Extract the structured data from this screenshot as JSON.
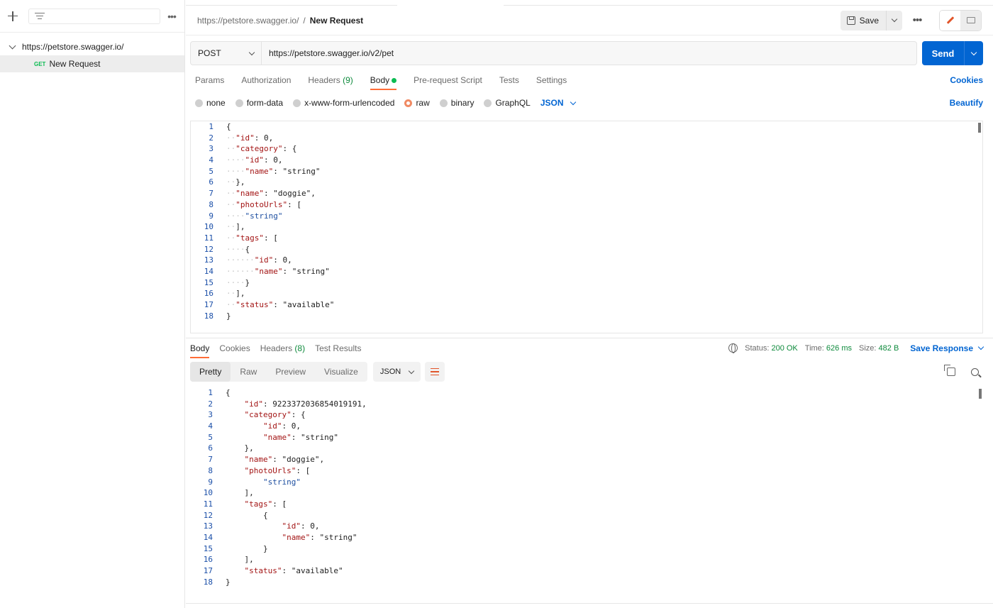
{
  "sidebar": {
    "collection_name": "https://petstore.swagger.io/",
    "request": {
      "method": "GET",
      "name": "New Request"
    }
  },
  "header": {
    "breadcrumb_parent": "https://petstore.swagger.io/",
    "breadcrumb_sep": "/",
    "breadcrumb_current": "New Request",
    "save_label": "Save"
  },
  "request": {
    "method": "POST",
    "url": "https://petstore.swagger.io/v2/pet",
    "send_label": "Send",
    "tabs": {
      "params": "Params",
      "authorization": "Authorization",
      "headers": "Headers",
      "headers_count": "(9)",
      "body": "Body",
      "prerequest": "Pre-request Script",
      "tests": "Tests",
      "settings": "Settings",
      "cookies": "Cookies"
    },
    "body_types": [
      "none",
      "form-data",
      "x-www-form-urlencoded",
      "raw",
      "binary",
      "GraphQL"
    ],
    "body_type_selected": "raw",
    "format": "JSON",
    "beautify": "Beautify",
    "body_lines": [
      "{",
      "  \"id\": 0,",
      "  \"category\": {",
      "    \"id\": 0,",
      "    \"name\": \"string\"",
      "  },",
      "  \"name\": \"doggie\",",
      "  \"photoUrls\": [",
      "    \"string\"",
      "  ],",
      "  \"tags\": [",
      "    {",
      "      \"id\": 0,",
      "      \"name\": \"string\"",
      "    }",
      "  ],",
      "  \"status\": \"available\"",
      "}"
    ]
  },
  "response": {
    "tabs": {
      "body": "Body",
      "cookies": "Cookies",
      "headers": "Headers",
      "headers_count": "(8)",
      "tests": "Test Results"
    },
    "status_label": "Status:",
    "status_value": "200 OK",
    "time_label": "Time:",
    "time_value": "626 ms",
    "size_label": "Size:",
    "size_value": "482 B",
    "save_response": "Save Response",
    "views": [
      "Pretty",
      "Raw",
      "Preview",
      "Visualize"
    ],
    "view_selected": "Pretty",
    "format": "JSON",
    "body_lines": [
      "{",
      "    \"id\": 9223372036854019191,",
      "    \"category\": {",
      "        \"id\": 0,",
      "        \"name\": \"string\"",
      "    },",
      "    \"name\": \"doggie\",",
      "    \"photoUrls\": [",
      "        \"string\"",
      "    ],",
      "    \"tags\": [",
      "        {",
      "            \"id\": 0,",
      "            \"name\": \"string\"",
      "        }",
      "    ],",
      "    \"status\": \"available\"",
      "}"
    ]
  },
  "colors": {
    "accent": "#ff6c37",
    "send": "#0265d2",
    "success": "#0cbb52"
  }
}
